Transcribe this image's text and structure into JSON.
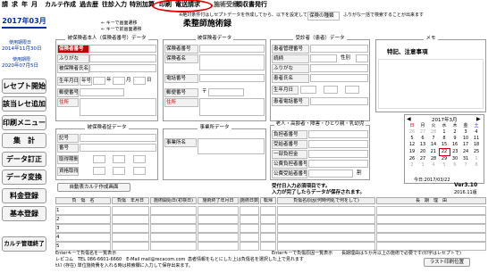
{
  "menu": [
    "請",
    "求",
    "年",
    "月",
    "カルテ作成",
    "過去歴",
    "往診入力",
    "特別加算",
    "印刷",
    "電送請求",
    "施術受療",
    "領収書発行"
  ],
  "sidebar": {
    "year_month": "2017年03月",
    "contract_label": "使用期限日",
    "contract_date": "2014年11月30日",
    "expire_label": "使用期限",
    "expire_date": "2020年07月5日",
    "buttons": [
      "レセプト開始",
      "該当レセ追加",
      "印刷メニュー",
      "集　計",
      "データ訂正",
      "データ変換",
      "料金登録",
      "基本登録",
      "カルテ管理終了"
    ]
  },
  "top_note": "※絶対条件付はしセプトデータを作成してから、以下を設定して下さい。",
  "form_title": "柔整師施術録",
  "right_note": "ふりがな一括で検索することが出来ます",
  "ins_label": "保険の種類",
  "arrow_note": "← キーで画面遷移",
  "arrow_note2": "← キーで前画面遷移",
  "insured": {
    "title": "被保険者本人（保険者番号）データ",
    "fields": [
      "保険者番号",
      "ふりがな",
      "被保険者氏名",
      "生年月日",
      "郵便番号",
      "住所"
    ],
    "year_label": "年号",
    "y": "年",
    "m": "月",
    "d": "日"
  },
  "patient": {
    "title": "被保険者データ",
    "fields": [
      "保険者番号",
      "保険者名",
      "電話番号",
      "郵便番号",
      "住所"
    ],
    "zip_mark": "〒"
  },
  "sub": {
    "title": "受診者（患者）データ",
    "fields": [
      "患者管理番号",
      "続柄",
      "ふりがな",
      "患者氏名",
      "生年月日",
      "患者電話番号"
    ],
    "sex": "性別"
  },
  "memo": {
    "title": "メモ",
    "text": "特記、注意事項"
  },
  "elderly": {
    "title": "老人・高齢者・障害・ひとり親・乳幼児",
    "fields": [
      "負担者番号",
      "受給者番号",
      "一部負担金",
      "公費負担者番号",
      "公費受給者番号"
    ],
    "ratio": "割"
  },
  "other_ins": {
    "title": "被保険者証データ",
    "fields": [
      "記号",
      "番号",
      "取得期間",
      "資格取得"
    ]
  },
  "office": {
    "title": "事業所データ",
    "field": "事業所名"
  },
  "calendar": {
    "title": "2017年3月",
    "days": [
      "日",
      "月",
      "火",
      "水",
      "木",
      "金",
      "土"
    ],
    "weeks": [
      [
        "26",
        "27",
        "28",
        "1",
        "2",
        "3",
        "4"
      ],
      [
        "5",
        "6",
        "7",
        "8",
        "9",
        "10",
        "11"
      ],
      [
        "12",
        "13",
        "14",
        "15",
        "16",
        "17",
        "18"
      ],
      [
        "19",
        "20",
        "21",
        "22",
        "23",
        "24",
        "25"
      ],
      [
        "26",
        "27",
        "28",
        "29",
        "30",
        "31",
        "1"
      ],
      [
        "2",
        "3",
        "4",
        "5",
        "6",
        "7",
        "8"
      ]
    ],
    "today": "今日:2017/03/22"
  },
  "version": "Ver3.10",
  "version_date": "2016.11版",
  "reg_note": "受付日入力必須項目です。",
  "reg_note2": "入力が完了したらデータが保存されます。",
  "auto_btn": "自動表カルテ作成画面",
  "table": {
    "headers": [
      "負　傷　名",
      "負傷　年月日",
      "施術開始日(初検日)",
      "施術終了年月日",
      "施術日数",
      "転帰",
      "負傷名原因(何時何処で何をして)",
      "長　期　理　由"
    ],
    "rows": [
      "1",
      "2",
      "3",
      "4",
      "5"
    ]
  },
  "footer": {
    "left": "Enterキーで負傷名を一覧表示",
    "contact": "レピコム　TEL 086-6601-6660　E-Mail mail@recacom.com",
    "note": "患者情報をもとにした上は負傷名を選択した上で見れます",
    "right": "Enterキーで負傷原因一覧表示",
    "right2": "長期理由は５か月以上の施術で必要です(印字はレセプトで)",
    "info": "ｾﾙﾌ (存在) 単位施術費を入れる時は検索欄に入力して保存出来ます。",
    "info2": "次の入力はEnterキーを押して下さい",
    "print_btn": "ラスト印刷位置"
  }
}
